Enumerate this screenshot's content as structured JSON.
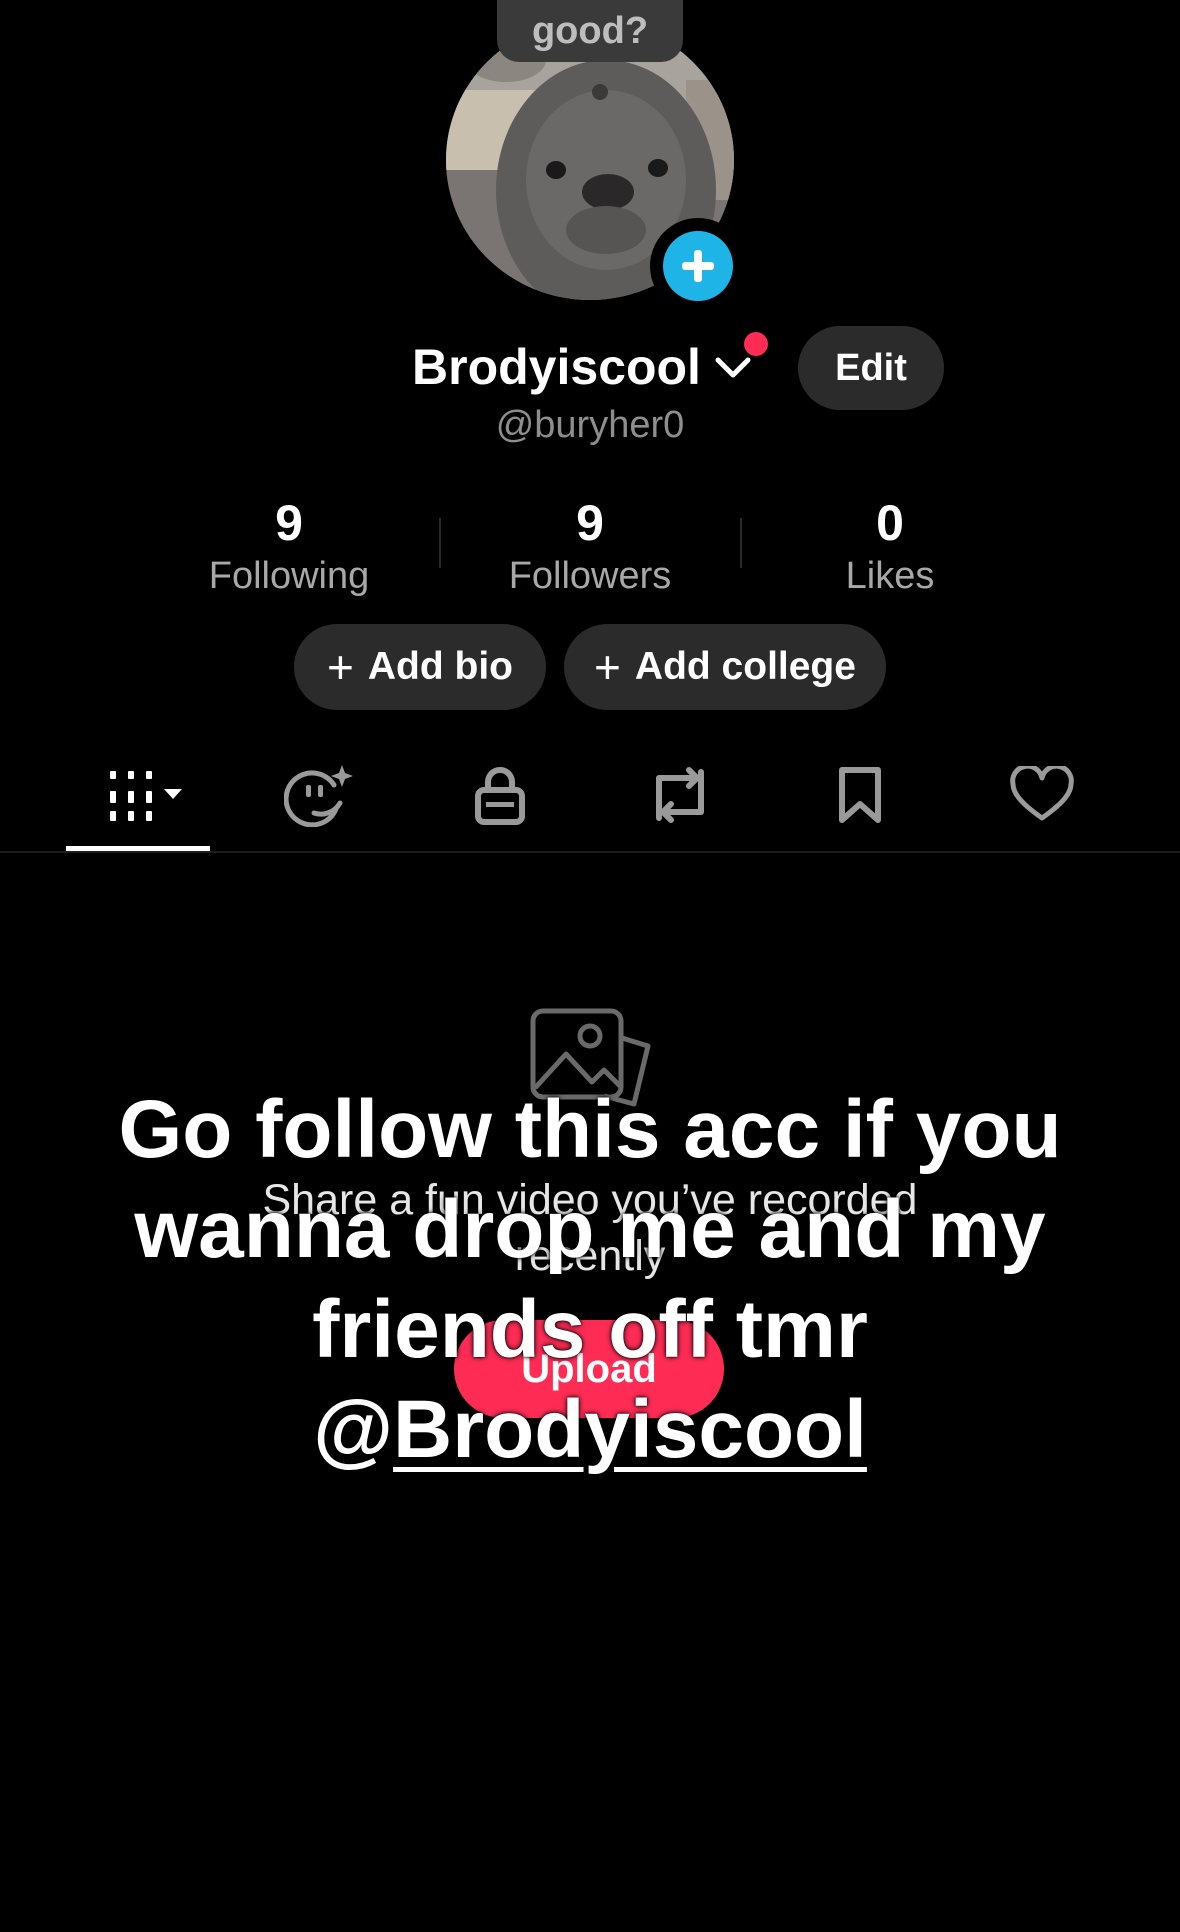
{
  "note": {
    "text": "good?"
  },
  "profile": {
    "display_name": "Brodyiscool",
    "handle": "@buryher0",
    "edit_label": "Edit"
  },
  "stats": [
    {
      "value": "9",
      "label": "Following"
    },
    {
      "value": "9",
      "label": "Followers"
    },
    {
      "value": "0",
      "label": "Likes"
    }
  ],
  "actions": {
    "add_bio": "Add bio",
    "add_college": "Add college",
    "plus": "+"
  },
  "tabs": [
    {
      "icon": "grid-icon",
      "active": true
    },
    {
      "icon": "face-sparkle-icon"
    },
    {
      "icon": "lock-icon"
    },
    {
      "icon": "repost-icon"
    },
    {
      "icon": "bookmark-icon"
    },
    {
      "icon": "heart-icon"
    }
  ],
  "empty_state": {
    "icon": "photo-icon",
    "message": "Share a fun video you’ve recorded recently",
    "upload_label": "Upload"
  },
  "overlay": {
    "line1": "Go follow this acc if you",
    "line2": "wanna drop me and my",
    "line3": "friends off tmr",
    "mention_prefix": "@",
    "mention_name": "Brodyiscool"
  },
  "colors": {
    "background": "#000000",
    "accent_red": "#fe2c55",
    "accent_blue": "#1fb4e8",
    "pill_bg": "#2b2b2b"
  }
}
